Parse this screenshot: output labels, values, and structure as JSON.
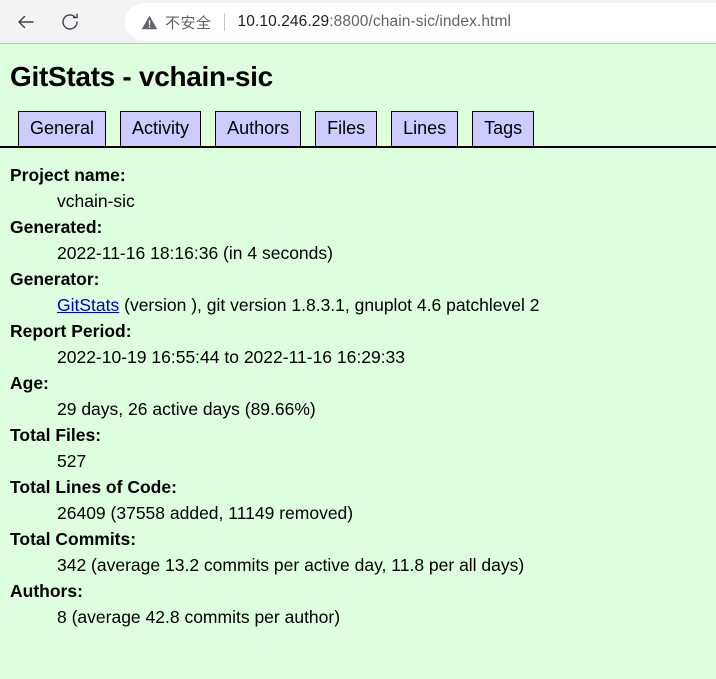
{
  "browser": {
    "back_label": "Back",
    "back_icon": "arrow-left-icon",
    "reload_label": "Reload",
    "reload_icon": "reload-icon",
    "security_icon": "warning-triangle-icon",
    "security_text": "不安全",
    "url_host": "10.10.246.29",
    "url_rest": ":8800/chain-sic/index.html"
  },
  "page": {
    "title": "GitStats - vchain-sic",
    "background_color": "#ddffdd",
    "tab_color": "#ccccff",
    "link_color": "#0000cc",
    "tabs": [
      {
        "label": "General"
      },
      {
        "label": "Activity"
      },
      {
        "label": "Authors"
      },
      {
        "label": "Files"
      },
      {
        "label": "Lines"
      },
      {
        "label": "Tags"
      }
    ],
    "stats": [
      {
        "label": "Project name:",
        "value": "vchain-sic"
      },
      {
        "label": "Generated:",
        "value": "2022-11-16 18:16:36 (in 4 seconds)"
      },
      {
        "label": "Generator:",
        "link_text": "GitStats",
        "value_after_link": " (version ), git version 1.8.3.1, gnuplot 4.6 patchlevel 2"
      },
      {
        "label": "Report Period:",
        "value": "2022-10-19 16:55:44 to 2022-11-16 16:29:33"
      },
      {
        "label": "Age:",
        "value": "29 days, 26 active days (89.66%)"
      },
      {
        "label": "Total Files:",
        "value": "527"
      },
      {
        "label": "Total Lines of Code:",
        "value": "26409 (37558 added, 11149 removed)"
      },
      {
        "label": "Total Commits:",
        "value": "342 (average 13.2 commits per active day, 11.8 per all days)"
      },
      {
        "label": "Authors:",
        "value": "8 (average 42.8 commits per author)"
      }
    ]
  }
}
